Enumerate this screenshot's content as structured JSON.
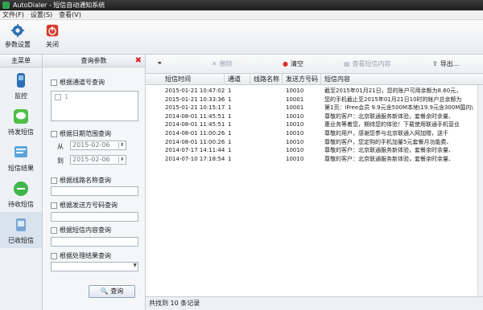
{
  "window": {
    "title": "AutoDialer - 短信自动通知系统"
  },
  "menu": [
    "文件(F)",
    "设置(S)",
    "查看(V)"
  ],
  "toolbar": {
    "settings_label": "参数设置",
    "close_label": "关闭"
  },
  "sidebar": {
    "header": "主菜单",
    "items": [
      {
        "label": "监控",
        "icon": "monitor-icon"
      },
      {
        "label": "待发短信",
        "icon": "pending-sms-icon"
      },
      {
        "label": "短信结果",
        "icon": "sms-result-icon"
      },
      {
        "label": "待收短信",
        "icon": "incoming-sms-icon"
      },
      {
        "label": "已收短信",
        "icon": "received-sms-icon",
        "active": true
      }
    ]
  },
  "query": {
    "header": "查询参数",
    "by_channel": "根据通道号查询",
    "channel_option": "1",
    "by_date": "根据日期范围查询",
    "from_label": "从",
    "to_label": "到",
    "from_date": "2015-02-06",
    "to_date": "2015-02-06",
    "by_line": "根据线路名称查询",
    "by_sender": "根据发送方号码查询",
    "by_content": "根据短信内容查询",
    "by_result": "根据处理结果查询",
    "search_label": "查询"
  },
  "main_toolbar": {
    "delete_label": "删除",
    "clear_label": "清空",
    "view_label": "查看短信内容",
    "export_label": "导出..."
  },
  "table": {
    "columns": [
      "短信时间",
      "通道",
      "线路名称",
      "发送方号码",
      "短信内容"
    ],
    "rows": [
      [
        "2015-01-21 10:47:02",
        "1",
        "",
        "10010",
        "截至2015年01月21日，您的账户可用余额为8.60元，"
      ],
      [
        "2015-01-21 10:33:36",
        "1",
        "",
        "10001",
        "您的手机截止至2015年01月21日10时的帐户总余额为"
      ],
      [
        "2015-01-21 10:15:17",
        "1",
        "",
        "10001",
        "第1页：iFree会员 9.9元含500M本地\\19.9元含300M国内\\"
      ],
      [
        "2014-08-01 11:45:51",
        "1",
        "",
        "10010",
        "尊敬的客户：北京联通服务新体验，套餐余时余量、"
      ],
      [
        "2014-08-01 11:45:51",
        "1",
        "",
        "10010",
        "惠业务等着您，期待您的体验！下载使用联通手机营业"
      ],
      [
        "2014-08-01 11:00:26",
        "1",
        "",
        "10010",
        "尊敬的用户，感谢您参与北京联通入网加赠，送千"
      ],
      [
        "2014-08-01 11:00:26",
        "1",
        "",
        "10010",
        "尊敬的客户，您定购的手机加量5元套餐月功能费、"
      ],
      [
        "2014-07-17 14:11:44",
        "1",
        "",
        "10010",
        "尊敬的客户：北京联通服务新体验，套餐余时余量、"
      ],
      [
        "2014-07-10 17:18:54",
        "1",
        "",
        "10010",
        "尊敬的客户：北京联通服务新体验，套餐余时余量、"
      ]
    ]
  },
  "status": {
    "text": "共找到 10 条记录"
  }
}
